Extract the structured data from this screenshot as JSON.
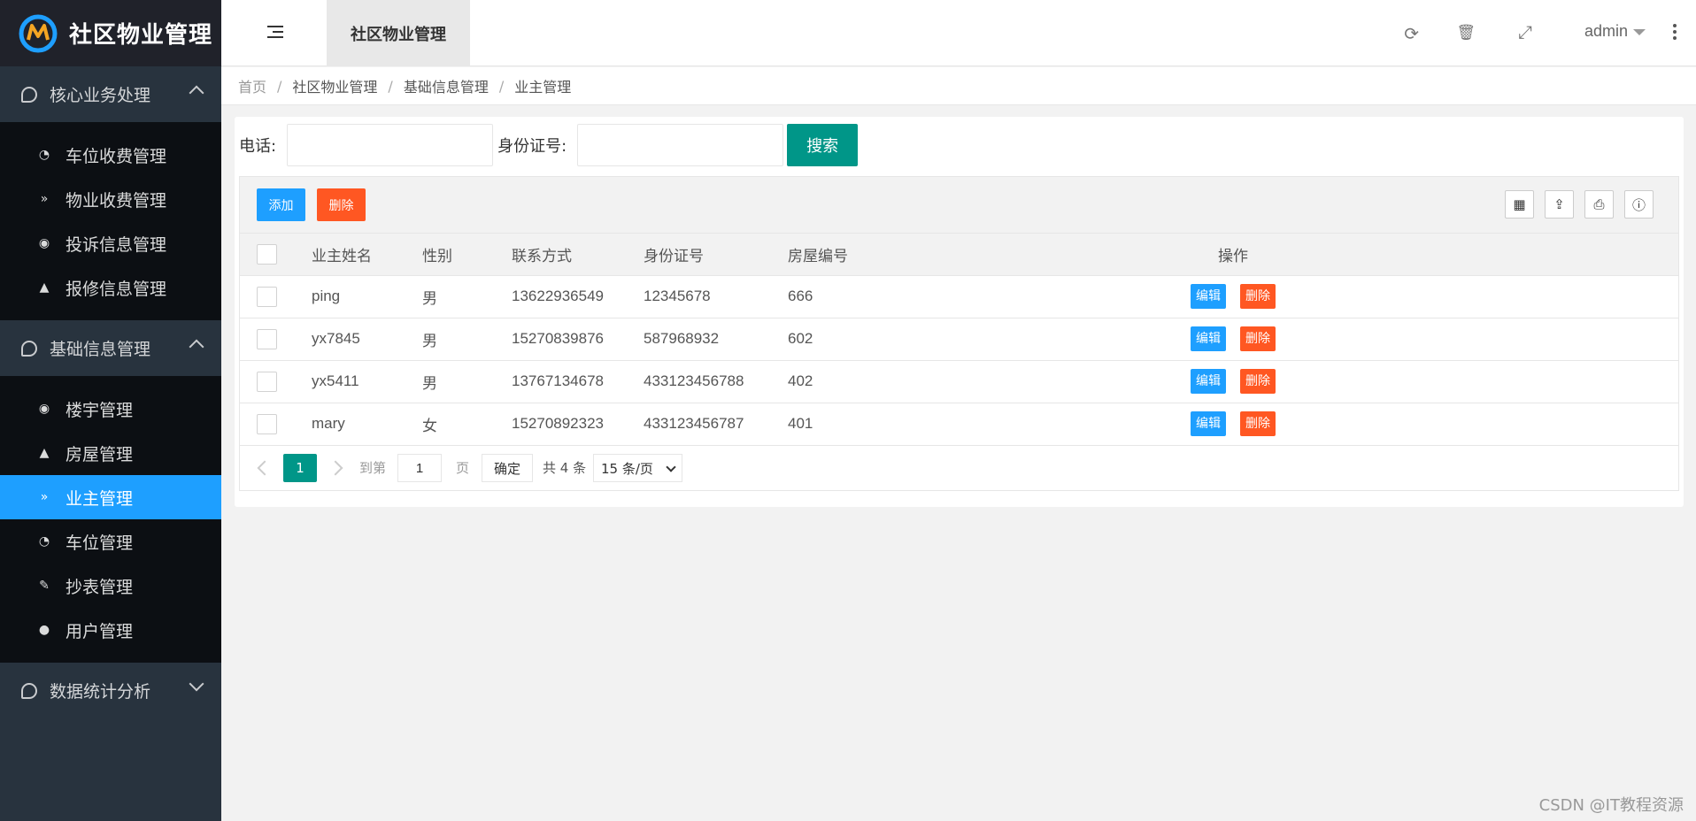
{
  "app": {
    "title": "社区物业管理"
  },
  "sidebar": {
    "groups": [
      {
        "label": "核心业务处理",
        "expanded": true,
        "items": [
          {
            "label": "车位收费管理",
            "icon": "dashboard-icon"
          },
          {
            "label": "物业收费管理",
            "icon": "double-chevron-icon"
          },
          {
            "label": "投诉信息管理",
            "icon": "target-icon"
          },
          {
            "label": "报修信息管理",
            "icon": "up-circle-icon"
          }
        ]
      },
      {
        "label": "基础信息管理",
        "expanded": true,
        "items": [
          {
            "label": "楼宇管理",
            "icon": "target-icon"
          },
          {
            "label": "房屋管理",
            "icon": "up-circle-icon"
          },
          {
            "label": "业主管理",
            "icon": "double-chevron-icon",
            "active": true
          },
          {
            "label": "车位管理",
            "icon": "dashboard-icon"
          },
          {
            "label": "抄表管理",
            "icon": "edit-icon"
          },
          {
            "label": "用户管理",
            "icon": "user-icon"
          }
        ]
      },
      {
        "label": "数据统计分析",
        "expanded": false,
        "items": []
      }
    ]
  },
  "header": {
    "tab": "社区物业管理",
    "user": "admin"
  },
  "breadcrumb": [
    "首页",
    "社区物业管理",
    "基础信息管理",
    "业主管理"
  ],
  "search": {
    "phone_label": "电话:",
    "phone_value": "",
    "idcard_label": "身份证号:",
    "idcard_value": "",
    "button": "搜索"
  },
  "toolbar": {
    "add": "添加",
    "delete": "删除"
  },
  "table": {
    "columns": [
      "业主姓名",
      "性别",
      "联系方式",
      "身份证号",
      "房屋编号",
      "操作"
    ],
    "rows": [
      {
        "name": "ping",
        "gender": "男",
        "phone": "13622936549",
        "idcard": "12345678",
        "house": "666"
      },
      {
        "name": "yx7845",
        "gender": "男",
        "phone": "15270839876",
        "idcard": "587968932",
        "house": "602"
      },
      {
        "name": "yx5411",
        "gender": "男",
        "phone": "13767134678",
        "idcard": "433123456788",
        "house": "402"
      },
      {
        "name": "mary",
        "gender": "女",
        "phone": "15270892323",
        "idcard": "433123456787",
        "house": "401"
      }
    ],
    "row_actions": {
      "edit": "编辑",
      "delete": "删除"
    }
  },
  "pager": {
    "current_page": "1",
    "goto_prefix": "到第",
    "goto_value": "1",
    "goto_suffix": "页",
    "confirm": "确定",
    "total": "共 4 条",
    "page_size": "15 条/页"
  },
  "watermark": "CSDN @IT教程资源",
  "colors": {
    "sidebar": "#28333e",
    "active": "#1e9fff",
    "primary": "#009688",
    "danger": "#ff5722"
  }
}
